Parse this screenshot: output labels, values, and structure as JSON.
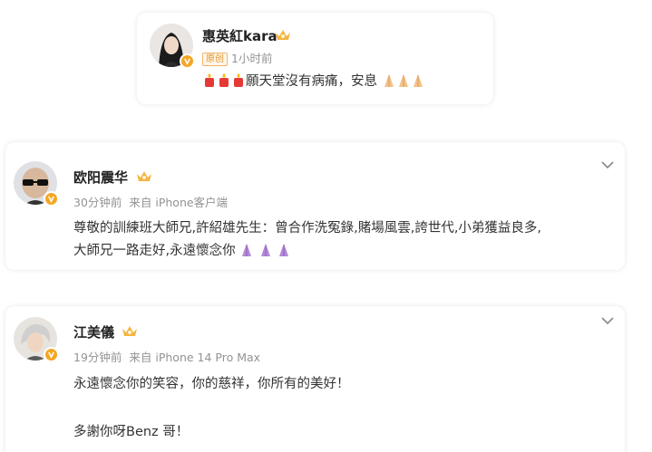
{
  "posts": [
    {
      "username": "惠英紅kara",
      "tag": "原创",
      "time": "1小时前",
      "text": "願天堂沒有病痛，安息"
    },
    {
      "username": "欧阳震华",
      "time": "30分钟前",
      "source": "来自 iPhone客户端",
      "line1": "尊敬的訓練班大師兄,許紹雄先生：曾合作洗冤錄,賭場風雲,誇世代,小弟獲益良多,",
      "line2": "大師兄一路走好,永遠懷念你"
    },
    {
      "username": "江美儀",
      "time": "19分钟前",
      "source": "来自 iPhone 14 Pro Max",
      "line1": "永遠懷念你的笑容，你的慈祥，你所有的美好！",
      "line2": "多謝你呀Benz 哥！"
    }
  ],
  "icons": {
    "verified": "verified-badge-icon",
    "crown": "crown-icon",
    "more": "chevron-down-icon",
    "candle": "candle-emoji-icon",
    "pray": "pray-emoji-icon"
  },
  "colors": {
    "verified": "#f5a623",
    "crown": "#f3b640",
    "candle": "#e53935",
    "meta": "#939393"
  }
}
